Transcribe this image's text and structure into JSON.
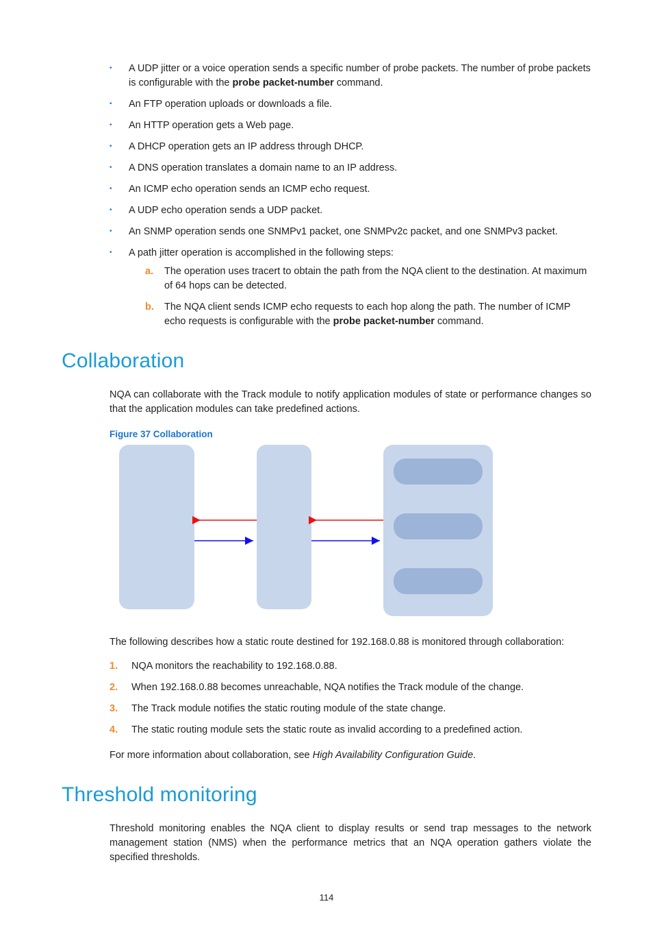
{
  "bullets": [
    {
      "pre": "A UDP jitter or a voice operation sends a specific number of probe packets. The number of probe packets is configurable with the ",
      "bold": "probe packet-number",
      "post": " command."
    },
    {
      "text": "An FTP operation uploads or downloads a file."
    },
    {
      "text": "An HTTP operation gets a Web page."
    },
    {
      "text": "A DHCP operation gets an IP address through DHCP."
    },
    {
      "text": "A DNS operation translates a domain name to an IP address."
    },
    {
      "text": "An ICMP echo operation sends an ICMP echo request."
    },
    {
      "text": "A UDP echo operation sends a UDP packet."
    },
    {
      "text": "An SNMP operation sends one SNMPv1 packet, one SNMPv2c packet, and one SNMPv3 packet."
    },
    {
      "text": "A path jitter operation is accomplished in the following steps:"
    }
  ],
  "substeps": [
    {
      "marker": "a.",
      "text": "The operation uses tracert to obtain the path from the NQA client to the destination. At maximum of 64 hops can be detected."
    },
    {
      "marker": "b.",
      "pre": "The NQA client sends ICMP echo requests to each hop along the path. The number of ICMP echo requests is configurable with the ",
      "bold": "probe packet-number",
      "post": " command."
    }
  ],
  "collab": {
    "heading": "Collaboration",
    "intro": "NQA can collaborate with the Track module to notify application modules of state or performance changes so that the application modules can take predefined actions.",
    "figcap": "Figure 37 Collaboration",
    "following": "The following describes how a static route destined for 192.168.0.88 is monitored through collaboration:",
    "steps": [
      "NQA monitors the reachability to 192.168.0.88.",
      "When 192.168.0.88 becomes unreachable, NQA notifies the Track module of the change.",
      "The Track module notifies the static routing module of the state change.",
      "The static routing module sets the static route as invalid according to a predefined action."
    ],
    "moreinfo_pre": "For more information about collaboration, see ",
    "moreinfo_italic": "High Availability Configuration Guide",
    "moreinfo_post": "."
  },
  "threshold": {
    "heading": "Threshold monitoring",
    "intro": "Threshold monitoring enables the NQA client to display results or send trap messages to the network management station (NMS) when the performance metrics that an NQA operation gathers violate the specified thresholds."
  },
  "pagenum": "114"
}
